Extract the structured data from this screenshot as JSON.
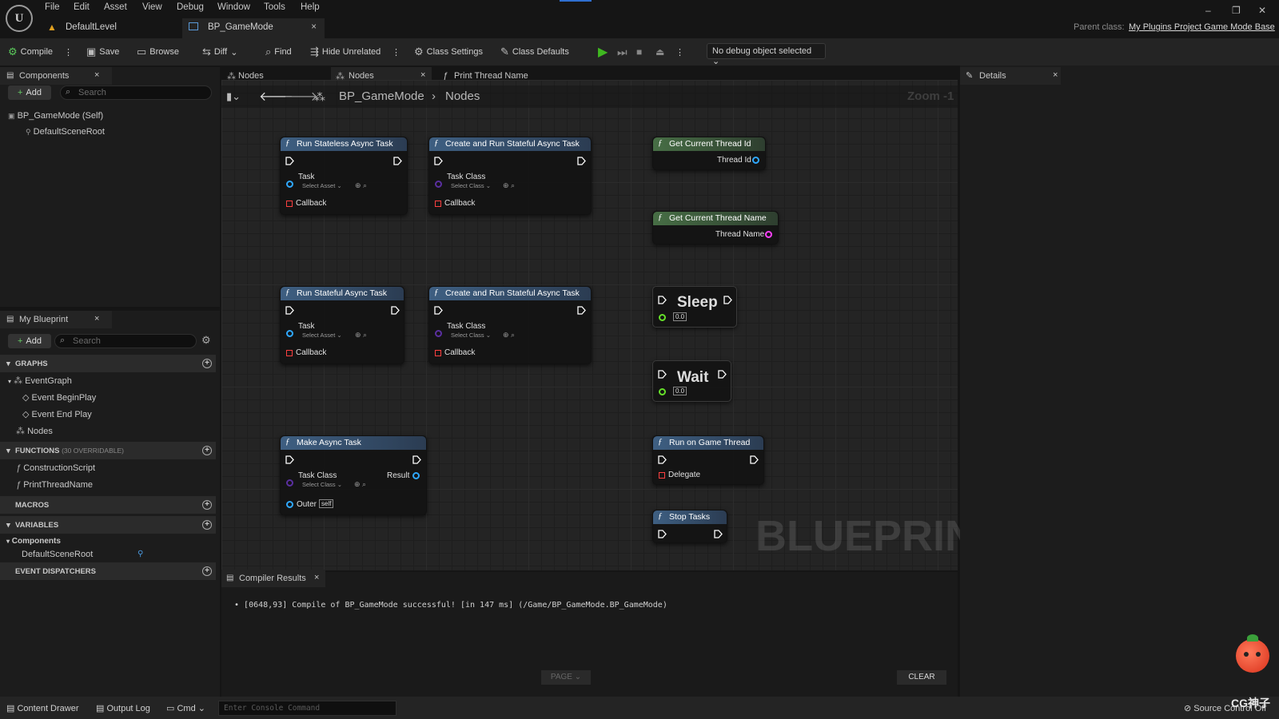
{
  "menu": [
    "File",
    "Edit",
    "Asset",
    "View",
    "Debug",
    "Window",
    "Tools",
    "Help"
  ],
  "doc_tabs": [
    {
      "label": "DefaultLevel"
    },
    {
      "label": "BP_GameMode"
    }
  ],
  "parent_class": {
    "label": "Parent class:",
    "value": "My Plugins Project Game Mode Base"
  },
  "toolbar": {
    "compile": "Compile",
    "save": "Save",
    "browse": "Browse",
    "diff": "Diff",
    "find": "Find",
    "hide_unrelated": "Hide Unrelated",
    "class_settings": "Class Settings",
    "class_defaults": "Class Defaults",
    "debug_object": "No debug object selected"
  },
  "components_panel": {
    "title": "Components",
    "add": "Add",
    "search_placeholder": "Search",
    "items": [
      "BP_GameMode (Self)",
      "DefaultSceneRoot"
    ]
  },
  "my_blueprint": {
    "title": "My Blueprint",
    "add": "Add",
    "search_placeholder": "Search",
    "graphs_header": "GRAPHS",
    "graphs": [
      "EventGraph",
      "Event BeginPlay",
      "Event End Play",
      "Nodes"
    ],
    "functions_header": "FUNCTIONS",
    "functions_note": "(30 OVERRIDABLE)",
    "functions": [
      "ConstructionScript",
      "PrintThreadName"
    ],
    "macros_header": "MACROS",
    "variables_header": "VARIABLES",
    "components_group": "Components",
    "component_var": "DefaultSceneRoot",
    "dispatchers_header": "EVENT DISPATCHERS"
  },
  "graph_tabs": [
    "Nodes",
    "Nodes",
    "Print Thread Name"
  ],
  "breadcrumb": {
    "root": "BP_GameMode",
    "current": "Nodes"
  },
  "zoom_label": "Zoom -1",
  "watermark": "BLUEPRINT",
  "nodes": {
    "run_stateless": {
      "title": "Run Stateless Async Task",
      "pin": "Task",
      "select": "Select Asset",
      "callback": "Callback"
    },
    "create_run_1": {
      "title": "Create and Run Stateful Async Task",
      "pin": "Task Class",
      "select": "Select Class",
      "callback": "Callback"
    },
    "get_thread_id": {
      "title": "Get Current Thread Id",
      "out": "Thread Id"
    },
    "get_thread_name": {
      "title": "Get Current Thread Name",
      "out": "Thread Name"
    },
    "run_stateful": {
      "title": "Run Stateful Async Task",
      "pin": "Task",
      "select": "Select Asset",
      "callback": "Callback"
    },
    "create_run_2": {
      "title": "Create and Run Stateful Async Task",
      "pin": "Task Class",
      "select": "Select Class",
      "callback": "Callback"
    },
    "sleep": {
      "title": "Sleep",
      "value": "0.0"
    },
    "wait": {
      "title": "Wait",
      "value": "0.0"
    },
    "make_async": {
      "title": "Make Async Task",
      "pin": "Task Class",
      "select": "Select Class",
      "result": "Result",
      "outer": "Outer",
      "outer_value": "self"
    },
    "run_game_thread": {
      "title": "Run on Game Thread",
      "pin": "Delegate"
    },
    "stop_tasks": {
      "title": "Stop Tasks"
    }
  },
  "details": {
    "title": "Details"
  },
  "compiler": {
    "title": "Compiler Results",
    "message": "[0648,93] Compile of BP_GameMode successful! [in 147 ms] (/Game/BP_GameMode.BP_GameMode)",
    "page": "PAGE",
    "clear": "CLEAR"
  },
  "statusbar": {
    "content_drawer": "Content Drawer",
    "output_log": "Output Log",
    "cmd": "Cmd",
    "console_placeholder": "Enter Console Command",
    "source_control": "Source Control Off"
  },
  "corner_badge": "CG神子",
  "colors": {
    "play": "#3fb820",
    "exec_pin": "#ffffff",
    "object_pin": "#2fa8ff",
    "string_pin": "#ff40ff",
    "delegate_pin": "#ff3838",
    "float_pin": "#66e02a",
    "class_pin": "#5a2fa0"
  }
}
